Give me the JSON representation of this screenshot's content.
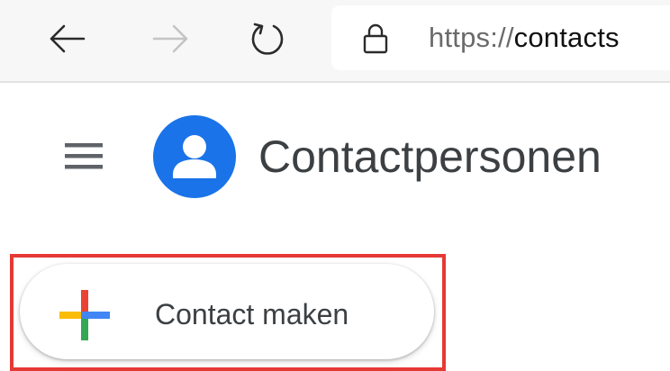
{
  "browser": {
    "url_scheme": "https://",
    "url_host": "contacts",
    "icons": {
      "back": "arrow-left-icon",
      "forward": "arrow-right-icon",
      "refresh": "refresh-icon",
      "lock": "lock-icon"
    }
  },
  "app": {
    "title": "Contactpersonen",
    "logo": "contacts-logo-icon",
    "menu_icon": "hamburger-menu-icon",
    "brand_color": "#1a73e8"
  },
  "create_button": {
    "label": "Contact maken",
    "icon": "plus-icon",
    "icon_colors": [
      "#ea4335",
      "#4285f4",
      "#34a853",
      "#fbbc04"
    ]
  },
  "highlight": {
    "color": "#e53935"
  }
}
